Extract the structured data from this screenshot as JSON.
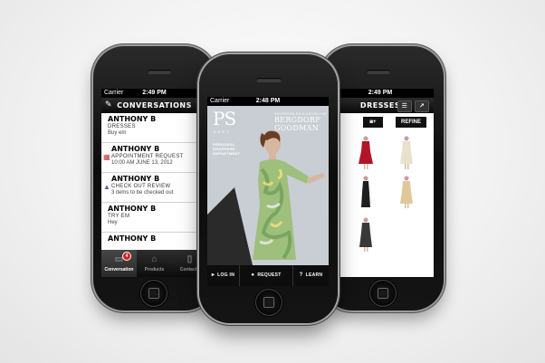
{
  "left_phone": {
    "status": {
      "carrier": "Carrier",
      "time": "2:49 PM"
    },
    "nav_title": "CONVERSATIONS",
    "conversations": [
      {
        "name": "ANTHONY B",
        "line2": "DRESSES",
        "line3": "Buy em",
        "num": "0"
      },
      {
        "name": "ANTHONY B",
        "line2": "APPOINTMENT REQUEST",
        "line3": "10:00 AM JUNE 13, 2012",
        "num": "0"
      },
      {
        "name": "ANTHONY B",
        "line2": "CHECK OUT REVIEW",
        "line3": "3 items to be checked out",
        "num": "0"
      },
      {
        "name": "ANTHONY B",
        "line2": "TRY EM",
        "line3": "Hey",
        "num": "0"
      },
      {
        "name": "ANTHONY B",
        "line2": "",
        "line3": "",
        "num": "0"
      }
    ],
    "tabs": [
      {
        "label": "Conversation",
        "badge": "4"
      },
      {
        "label": "Products"
      },
      {
        "label": "Contacts"
      }
    ]
  },
  "center_phone": {
    "status": {
      "carrier": "Carrier",
      "time": "2:48 PM"
    },
    "logo": "PS",
    "logo_sub": "DEPT",
    "brand_tagline": "SHOPPERS EXCLUSIVELY AT",
    "brand": "BERGDORF GOODMAN",
    "subtitle": "PERSONAL SHOPPERS DEPARTMENT",
    "bottom": [
      {
        "label": "LOG IN"
      },
      {
        "label": "REQUEST MEMBERSHIP"
      },
      {
        "label": "LEARN MORE"
      }
    ]
  },
  "right_phone": {
    "status": {
      "time": "2:49 PM"
    },
    "nav_title": "DRESSES",
    "refine_label": "REFINE",
    "left_cut_label": "D"
  },
  "colors": {
    "background": "#f1f1f1",
    "phone_body": "#111111",
    "badge": "#d62020"
  }
}
